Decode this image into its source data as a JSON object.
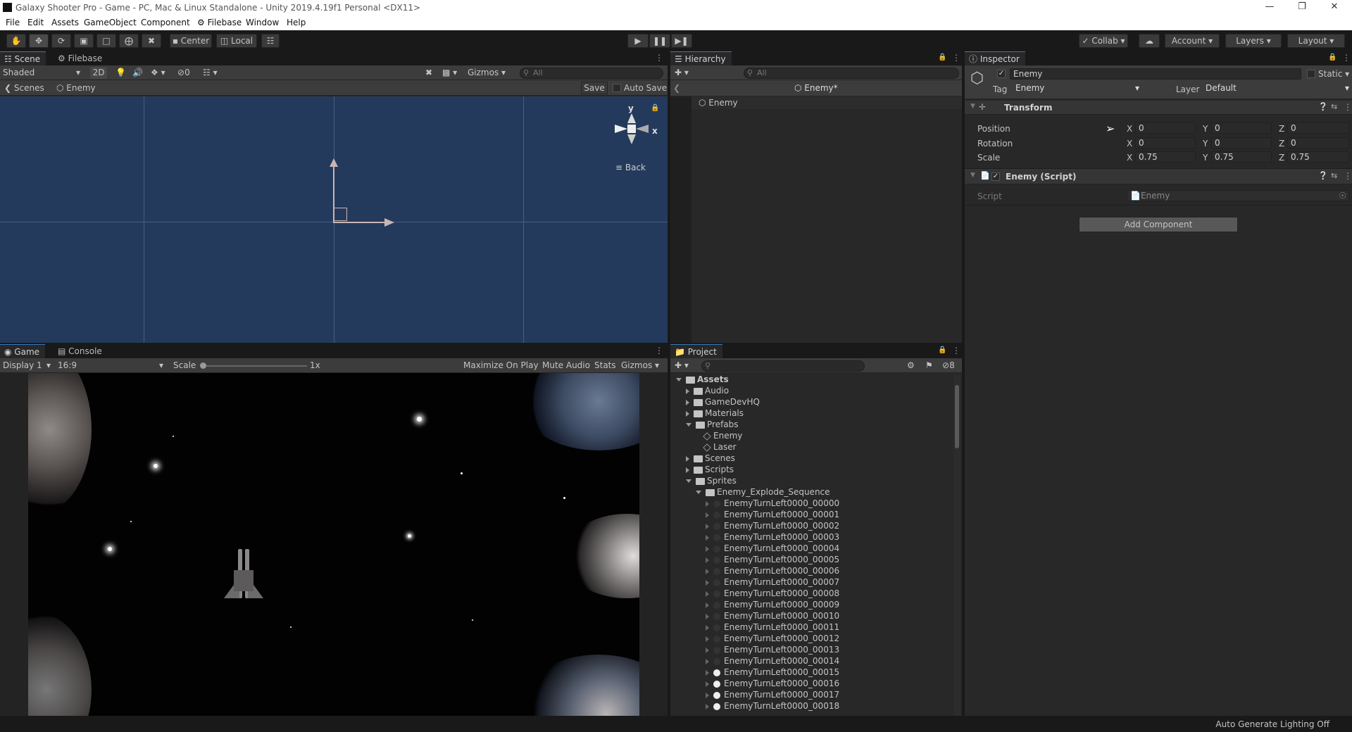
{
  "window": {
    "title": "Galaxy Shooter Pro - Game - PC, Mac & Linux Standalone - Unity 2019.4.19f1 Personal <DX11>"
  },
  "menu": [
    "File",
    "Edit",
    "Assets",
    "GameObject",
    "Component",
    "Filebase",
    "Window",
    "Help"
  ],
  "toolbar": {
    "pivot": "Center",
    "space": "Local",
    "collab": "Collab",
    "account": "Account",
    "layers": "Layers",
    "layout": "Layout"
  },
  "scene": {
    "tabs": [
      "Scene",
      "Filebase"
    ],
    "shading": "Shaded",
    "mode2d": "2D",
    "hidden_count": "0",
    "gizmos": "Gizmos",
    "search_placeholder": "All",
    "breadcrumb_root": "Scenes",
    "breadcrumb_prefab": "Enemy",
    "save": "Save",
    "autosave": "Auto Save",
    "gizmo_y": "y",
    "gizmo_x": "x",
    "view_label": "Back"
  },
  "hierarchy": {
    "tab": "Hierarchy",
    "search_placeholder": "All",
    "prefab_header": "Enemy*",
    "items": [
      "Enemy"
    ]
  },
  "inspector": {
    "tab": "Inspector",
    "object_name": "Enemy",
    "static_label": "Static",
    "tag_label": "Tag",
    "tag_value": "Enemy",
    "layer_label": "Layer",
    "layer_value": "Default",
    "transform": {
      "title": "Transform",
      "rows": [
        {
          "label": "Position",
          "x": "0",
          "y": "0",
          "z": "0"
        },
        {
          "label": "Rotation",
          "x": "0",
          "y": "0",
          "z": "0"
        },
        {
          "label": "Scale",
          "x": "0.75",
          "y": "0.75",
          "z": "0.75"
        }
      ]
    },
    "script_component": {
      "title": "Enemy (Script)",
      "field_label": "Script",
      "field_value": "Enemy"
    },
    "add_component": "Add Component"
  },
  "game": {
    "tabs": [
      "Game",
      "Console"
    ],
    "display": "Display 1",
    "aspect": "16:9",
    "scale_label": "Scale",
    "scale_value": "1x",
    "maximize": "Maximize On Play",
    "mute": "Mute Audio",
    "stats": "Stats",
    "gizmos": "Gizmos"
  },
  "project": {
    "tab": "Project",
    "hidden_count": "8",
    "tree": [
      {
        "label": "Assets",
        "depth": 0,
        "kind": "folder",
        "open": true
      },
      {
        "label": "Audio",
        "depth": 1,
        "kind": "folder",
        "open": false
      },
      {
        "label": "GameDevHQ",
        "depth": 1,
        "kind": "folder",
        "open": false
      },
      {
        "label": "Materials",
        "depth": 1,
        "kind": "folder",
        "open": false
      },
      {
        "label": "Prefabs",
        "depth": 1,
        "kind": "folder",
        "open": true
      },
      {
        "label": "Enemy",
        "depth": 2,
        "kind": "prefab"
      },
      {
        "label": "Laser",
        "depth": 2,
        "kind": "prefab"
      },
      {
        "label": "Scenes",
        "depth": 1,
        "kind": "folder",
        "open": false
      },
      {
        "label": "Scripts",
        "depth": 1,
        "kind": "folder",
        "open": false
      },
      {
        "label": "Sprites",
        "depth": 1,
        "kind": "folder",
        "open": true
      },
      {
        "label": "Enemy_Explode_Sequence",
        "depth": 2,
        "kind": "folder",
        "open": true
      },
      {
        "label": "EnemyTurnLeft0000_00000",
        "depth": 3,
        "kind": "sprite"
      },
      {
        "label": "EnemyTurnLeft0000_00001",
        "depth": 3,
        "kind": "sprite"
      },
      {
        "label": "EnemyTurnLeft0000_00002",
        "depth": 3,
        "kind": "sprite"
      },
      {
        "label": "EnemyTurnLeft0000_00003",
        "depth": 3,
        "kind": "sprite"
      },
      {
        "label": "EnemyTurnLeft0000_00004",
        "depth": 3,
        "kind": "sprite"
      },
      {
        "label": "EnemyTurnLeft0000_00005",
        "depth": 3,
        "kind": "sprite"
      },
      {
        "label": "EnemyTurnLeft0000_00006",
        "depth": 3,
        "kind": "sprite"
      },
      {
        "label": "EnemyTurnLeft0000_00007",
        "depth": 3,
        "kind": "sprite"
      },
      {
        "label": "EnemyTurnLeft0000_00008",
        "depth": 3,
        "kind": "sprite"
      },
      {
        "label": "EnemyTurnLeft0000_00009",
        "depth": 3,
        "kind": "sprite"
      },
      {
        "label": "EnemyTurnLeft0000_00010",
        "depth": 3,
        "kind": "sprite"
      },
      {
        "label": "EnemyTurnLeft0000_00011",
        "depth": 3,
        "kind": "sprite"
      },
      {
        "label": "EnemyTurnLeft0000_00012",
        "depth": 3,
        "kind": "sprite"
      },
      {
        "label": "EnemyTurnLeft0000_00013",
        "depth": 3,
        "kind": "sprite"
      },
      {
        "label": "EnemyTurnLeft0000_00014",
        "depth": 3,
        "kind": "sprite"
      },
      {
        "label": "EnemyTurnLeft0000_00015",
        "depth": 3,
        "kind": "sprite"
      },
      {
        "label": "EnemyTurnLeft0000_00016",
        "depth": 3,
        "kind": "sprite"
      },
      {
        "label": "EnemyTurnLeft0000_00017",
        "depth": 3,
        "kind": "sprite"
      },
      {
        "label": "EnemyTurnLeft0000_00018",
        "depth": 3,
        "kind": "sprite"
      }
    ]
  },
  "status": {
    "text": "Auto Generate Lighting Off"
  },
  "colors": {
    "scene_bg": "#243a5c",
    "panel_bg": "#282828",
    "accent": "#3a79bb"
  }
}
